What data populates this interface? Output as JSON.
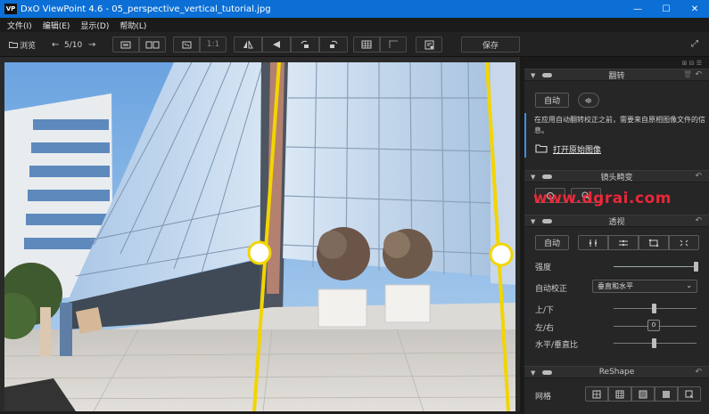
{
  "window": {
    "app_icon_text": "VP",
    "title": "DxO ViewPoint 4.6 - 05_perspective_vertical_tutorial.jpg",
    "minimize": "—",
    "maximize": "☐",
    "close": "✕"
  },
  "menu": {
    "items": [
      "文件(I)",
      "编辑(E)",
      "显示(D)",
      "帮助(L)"
    ]
  },
  "toolbar": {
    "browse_label": "浏览",
    "page_counter": "5/10",
    "zoom_label": "1:1",
    "save_label": "保存"
  },
  "panel": {
    "header_icons": "⊞ ⊟ ☰",
    "sections": {
      "flip": {
        "title": "翻转",
        "auto_label": "自动",
        "notice": "在应用自动翻转校正之前，需要来自原相图像文件的信息。",
        "open_original": "打开原始图像"
      },
      "lens": {
        "title": "镜头畸变"
      },
      "perspective": {
        "title": "透视",
        "auto_label": "自动",
        "intensity_label": "强度",
        "intensity_value": 100,
        "auto_correct_label": "自动校正",
        "auto_correct_value": "垂直和水平",
        "updown_label": "上/下",
        "updown_value": 0,
        "leftright_label": "左/右",
        "leftright_value": 0,
        "leftright_readout": "0",
        "ratio_label": "水平/垂直比",
        "ratio_value": 0
      },
      "reshape": {
        "title": "ReShape",
        "grid_label": "网格"
      }
    }
  },
  "watermark": "www.dgrai.com",
  "colors": {
    "titlebar": "#0b6fd6",
    "accent_line": "#f2d500",
    "panel_bg": "#262626"
  }
}
